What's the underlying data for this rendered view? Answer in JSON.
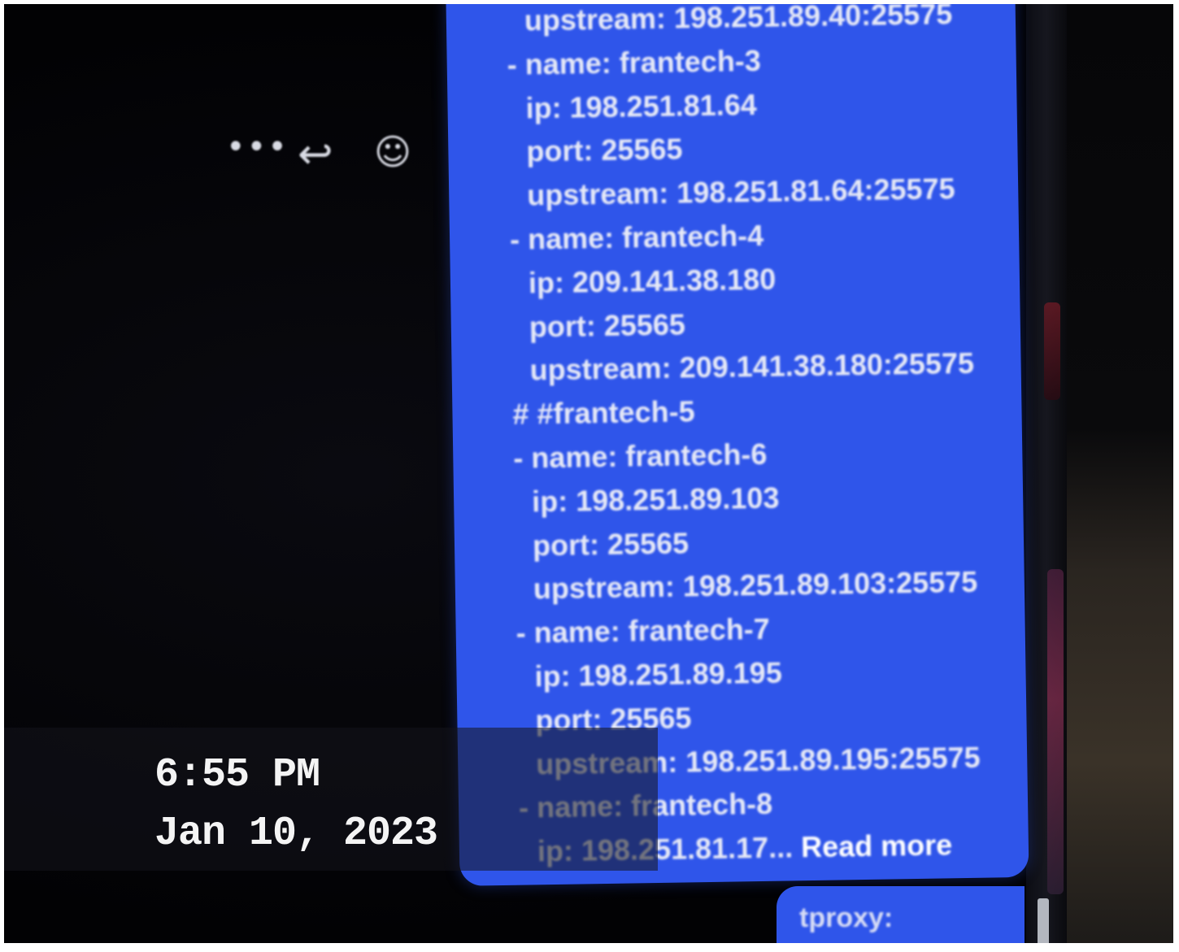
{
  "toolbar": {
    "more_icon": "more-icon",
    "reply_icon": "reply-icon",
    "add_reaction_icon": "add-reaction-icon"
  },
  "message": {
    "lines": [
      "upstream: 198.251.89.40:25575",
      "- name: frantech-3",
      "ip: 198.251.81.64",
      "port: 25565",
      "upstream: 198.251.81.64:25575",
      "- name: frantech-4",
      "ip: 209.141.38.180",
      "port: 25565",
      "upstream: 209.141.38.180:25575",
      "# #frantech-5",
      "- name: frantech-6",
      "ip: 198.251.89.103",
      "port: 25565",
      "upstream: 198.251.89.103:25575",
      "- name: frantech-7",
      "ip: 198.251.89.195",
      "port: 25565",
      "upstream: 198.251.89.195:25575",
      "- name: frantech-8",
      "ip: 198.251.81.17..."
    ],
    "read_more": "Read more",
    "bubble_color": "#2f55ea"
  },
  "reply_preview": {
    "text": "tproxy:"
  },
  "timestamp": {
    "time": "6:55 PM",
    "date": "Jan 10, 2023"
  }
}
